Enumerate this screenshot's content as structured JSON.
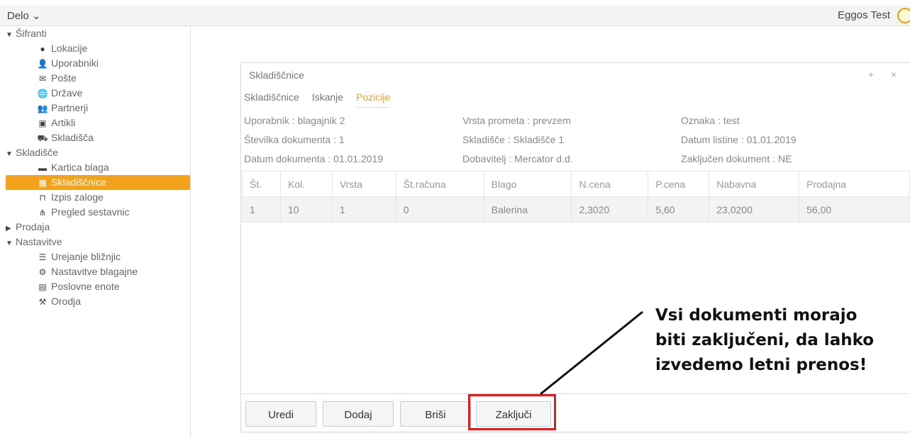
{
  "topbar": {
    "menu": "Delo ⌄",
    "user": "Eggos Test"
  },
  "sidebar": {
    "groups": [
      {
        "label": "Šifranti",
        "expanded": true,
        "items": [
          {
            "label": "Lokacije",
            "icon": "location-pin-icon",
            "glyph": "●"
          },
          {
            "label": "Uporabniki",
            "icon": "user-icon",
            "glyph": "👤"
          },
          {
            "label": "Pošte",
            "icon": "envelope-icon",
            "glyph": "✉"
          },
          {
            "label": "Države",
            "icon": "globe-icon",
            "glyph": "🌐"
          },
          {
            "label": "Partnerji",
            "icon": "partners-icon",
            "glyph": "👥"
          },
          {
            "label": "Artikli",
            "icon": "articles-icon",
            "glyph": "▣"
          },
          {
            "label": "Skladišča",
            "icon": "warehouse-icon",
            "glyph": "⛟"
          }
        ]
      },
      {
        "label": "Skladišče",
        "expanded": true,
        "items": [
          {
            "label": "Kartica blaga",
            "icon": "folder-icon",
            "glyph": "▬"
          },
          {
            "label": "Skladiščnice",
            "icon": "stock-icon",
            "glyph": "▦",
            "active": true
          },
          {
            "label": "Izpis zaloge",
            "icon": "tray-icon",
            "glyph": "⊓"
          },
          {
            "label": "Pregled sestavnic",
            "icon": "hierarchy-icon",
            "glyph": "⋔"
          }
        ]
      },
      {
        "label": "Prodaja",
        "expanded": false,
        "items": []
      },
      {
        "label": "Nastavitve",
        "expanded": true,
        "items": [
          {
            "label": "Urejanje bližnjic",
            "icon": "user-list-icon",
            "glyph": "☰"
          },
          {
            "label": "Nastavitve blagajne",
            "icon": "cogs-icon",
            "glyph": "⚙"
          },
          {
            "label": "Poslovne enote",
            "icon": "store-icon",
            "glyph": "▤"
          },
          {
            "label": "Orodja",
            "icon": "tools-icon",
            "glyph": "⚒"
          }
        ]
      }
    ]
  },
  "dialog": {
    "title": "Skladiščnice",
    "controls": "+ ×",
    "tabs": [
      "Skladiščnice",
      "Iskanje",
      "Pozicije"
    ],
    "active_tab": "Pozicije",
    "info": [
      [
        "Uporabnik : blagajnik 2",
        "Vrsta prometa : prevzem",
        "Oznaka : test"
      ],
      [
        "Številka dokumenta : 1",
        "Skladišče : Skladišče 1",
        "Datum listine : 01.01.2019"
      ],
      [
        "Datum dokumenta : 01.01.2019",
        "Dobavitelj : Mercator d.d.",
        "Zaključen dokument : NE"
      ]
    ],
    "table": {
      "headers": [
        "Št.",
        "Kol.",
        "Vrsta",
        "Št.računa",
        "Blago",
        "N.cena",
        "P.cena",
        "Nabavna",
        "Prodajna"
      ],
      "rows": [
        [
          "1",
          "10",
          "1",
          "0",
          "Balerina",
          "2,3020",
          "5,60",
          "23,0200",
          "56,00"
        ]
      ]
    },
    "buttons": [
      "Uredi",
      "Dodaj",
      "Briši",
      "Zaključi"
    ]
  },
  "annotation": {
    "lines": [
      "Vsi dokumenti morajo",
      "biti zaključeni, da lahko",
      "izvedemo letni prenos!"
    ],
    "highlight_color": "#d62126"
  },
  "colors": {
    "accent": "#f2a31b"
  }
}
